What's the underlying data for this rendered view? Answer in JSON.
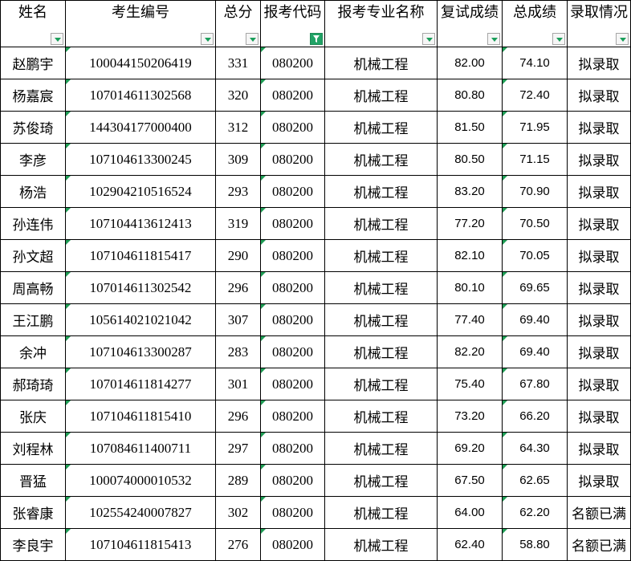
{
  "columns": [
    {
      "key": "name",
      "label": "姓名",
      "filter": "inactive"
    },
    {
      "key": "exam_id",
      "label": "考生编号",
      "filter": "inactive"
    },
    {
      "key": "total_score",
      "label": "总分",
      "filter": "inactive"
    },
    {
      "key": "major_code",
      "label": "报考代码",
      "filter": "active"
    },
    {
      "key": "major_name",
      "label": "报考专业名称",
      "filter": "inactive"
    },
    {
      "key": "retest_score",
      "label": "复试成绩",
      "filter": "inactive"
    },
    {
      "key": "final_score",
      "label": "总成绩",
      "filter": "inactive"
    },
    {
      "key": "status",
      "label": "录取情况",
      "filter": "inactive"
    }
  ],
  "rows": [
    [
      "赵鹏宇",
      "100044150206419",
      "331",
      "080200",
      "机械工程",
      "82.00",
      "74.10",
      "拟录取"
    ],
    [
      "杨嘉宸",
      "107014611302568",
      "320",
      "080200",
      "机械工程",
      "80.80",
      "72.40",
      "拟录取"
    ],
    [
      "苏俊琦",
      "144304177000400",
      "312",
      "080200",
      "机械工程",
      "81.50",
      "71.95",
      "拟录取"
    ],
    [
      "李彦",
      "107104613300245",
      "309",
      "080200",
      "机械工程",
      "80.50",
      "71.15",
      "拟录取"
    ],
    [
      "杨浩",
      "102904210516524",
      "293",
      "080200",
      "机械工程",
      "83.20",
      "70.90",
      "拟录取"
    ],
    [
      "孙连伟",
      "107104413612413",
      "319",
      "080200",
      "机械工程",
      "77.20",
      "70.50",
      "拟录取"
    ],
    [
      "孙文超",
      "107104611815417",
      "290",
      "080200",
      "机械工程",
      "82.10",
      "70.05",
      "拟录取"
    ],
    [
      "周高畅",
      "107014611302542",
      "296",
      "080200",
      "机械工程",
      "80.10",
      "69.65",
      "拟录取"
    ],
    [
      "王江鹏",
      "105614021021042",
      "307",
      "080200",
      "机械工程",
      "77.40",
      "69.40",
      "拟录取"
    ],
    [
      "余冲",
      "107104613300287",
      "283",
      "080200",
      "机械工程",
      "82.20",
      "69.40",
      "拟录取"
    ],
    [
      "郝琦琦",
      "107014611814277",
      "301",
      "080200",
      "机械工程",
      "75.40",
      "67.80",
      "拟录取"
    ],
    [
      "张庆",
      "107104611815410",
      "296",
      "080200",
      "机械工程",
      "73.20",
      "66.20",
      "拟录取"
    ],
    [
      "刘程林",
      "107084611400711",
      "297",
      "080200",
      "机械工程",
      "69.20",
      "64.30",
      "拟录取"
    ],
    [
      "晋猛",
      "100074000010532",
      "289",
      "080200",
      "机械工程",
      "67.50",
      "62.65",
      "拟录取"
    ],
    [
      "张睿康",
      "102554240007827",
      "302",
      "080200",
      "机械工程",
      "64.00",
      "62.20",
      "名额已满"
    ],
    [
      "李良宇",
      "107104611815413",
      "276",
      "080200",
      "机械工程",
      "62.40",
      "58.80",
      "名额已满"
    ]
  ],
  "icons": {
    "filter_inactive": "dropdown-arrow-icon",
    "filter_active": "funnel-filter-icon",
    "cell_marker": "number-as-text-marker-icon"
  },
  "colors": {
    "accent_green": "#21a366",
    "marker_green": "#1f9d55",
    "grid": "#000000"
  }
}
